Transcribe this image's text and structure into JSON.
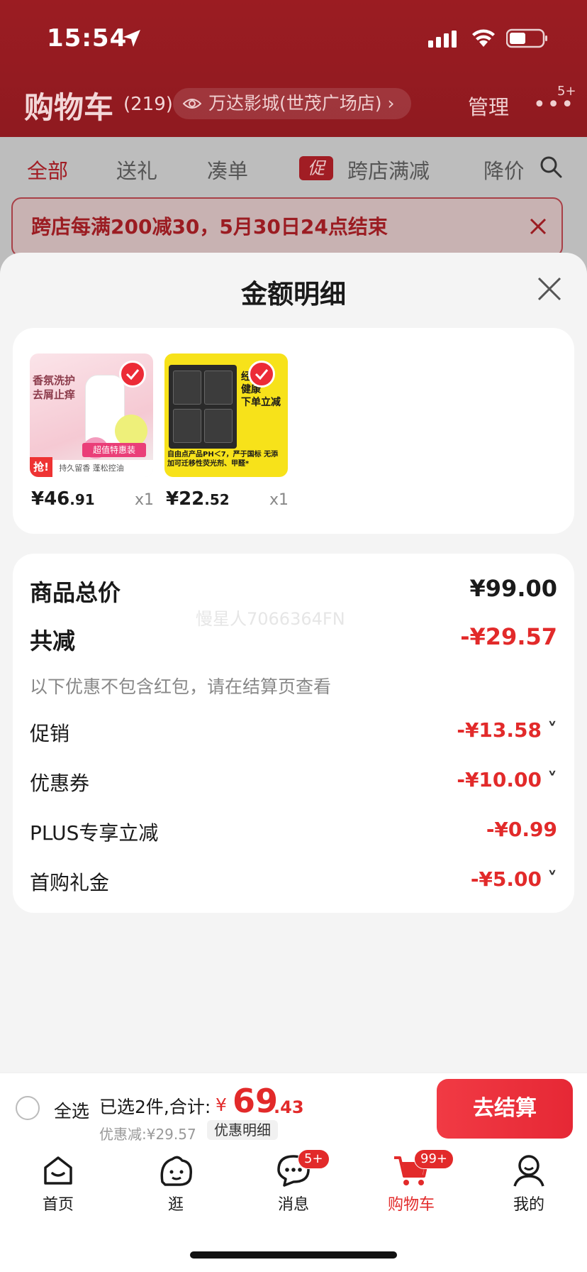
{
  "status_bar": {
    "time": "15:54"
  },
  "header": {
    "title": "购物车",
    "count": "(219)",
    "location": "万达影城(世茂广场店)",
    "location_chevron": "›",
    "manage": "管理",
    "more": "•••",
    "more_badge": "5+"
  },
  "tabs": {
    "items": [
      {
        "label": "全部"
      },
      {
        "label": "送礼"
      },
      {
        "label": "凑单"
      },
      {
        "label": "跨店满减",
        "badge": "促"
      },
      {
        "label": "降价"
      }
    ]
  },
  "promo_banner": {
    "text": "跨店每满200减30，5月30日24点结束"
  },
  "sheet": {
    "title": "金额明细",
    "products": [
      {
        "price_int": "¥46",
        "price_dec": ".91",
        "qty": "x1",
        "img_text_1": "香氛洗护",
        "img_text_2": "去屑止痒",
        "img_tag": "超值特惠装",
        "img_grab": "抢!",
        "img_bottom": "持久留香 蓬松控油"
      },
      {
        "price_int": "¥22",
        "price_dec": ".52",
        "qty": "x1",
        "img_right_1": "经期",
        "img_right_2": "健康",
        "img_right_3": "下单立减",
        "img_bottom": "自由点产品PH＜7，严于国标 无添加可迁移性荧光剂、甲醛*"
      }
    ],
    "summary": {
      "watermark": "慢星人7066364FN",
      "total_label": "商品总价",
      "total_value": "¥99.00",
      "reduce_label": "共减",
      "reduce_value": "-¥29.57",
      "note": "以下优惠不包含红包，请在结算页查看",
      "rows": [
        {
          "label": "促销",
          "value": "-¥13.58",
          "chevron": "˅"
        },
        {
          "label": "优惠券",
          "value": "-¥10.00",
          "chevron": "˅"
        },
        {
          "label": "PLUS专享立减",
          "value": "-¥0.99",
          "chevron": ""
        },
        {
          "label": "首购礼金",
          "value": "-¥5.00",
          "chevron": "˅"
        }
      ]
    }
  },
  "checkout": {
    "select_all": "全选",
    "selected_text": "已选2件,合计:",
    "total_yen": "¥",
    "total_int": "69",
    "total_dec": ".43",
    "discount_text": "优惠减:¥29.57",
    "discount_detail": "优惠明细",
    "checkout_button": "去结算"
  },
  "tabbar": {
    "items": [
      {
        "label": "首页",
        "icon": "home-icon"
      },
      {
        "label": "逛",
        "icon": "browse-icon"
      },
      {
        "label": "消息",
        "icon": "message-icon",
        "badge": "5+"
      },
      {
        "label": "购物车",
        "icon": "cart-icon",
        "badge": "99+",
        "active": true
      },
      {
        "label": "我的",
        "icon": "profile-icon"
      }
    ]
  },
  "colors": {
    "accent": "#e22a2a",
    "header_bg": "#9b1c22"
  }
}
